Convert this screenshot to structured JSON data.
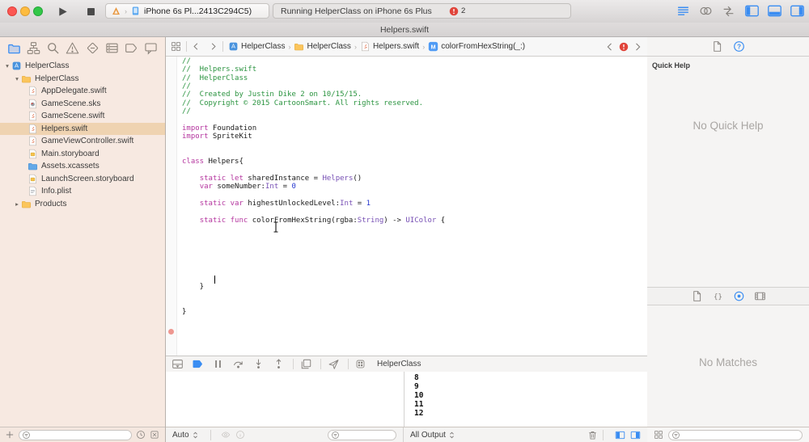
{
  "window": {
    "title": "Helpers.swift"
  },
  "toolbar": {
    "scheme": {
      "device_text": "iPhone 6s Pl...2413C294C5)"
    },
    "status": {
      "text": "Running HelperClass on iPhone 6s Plus",
      "error_count": "2"
    },
    "editor_buttons": [
      {
        "name": "standard-editor",
        "active": true
      },
      {
        "name": "assistant-editor"
      },
      {
        "name": "version-editor"
      }
    ],
    "view_buttons": [
      {
        "name": "navigator-panel",
        "active": true
      },
      {
        "name": "debug-panel",
        "active": true
      },
      {
        "name": "inspector-panel",
        "active": true
      }
    ]
  },
  "navigator": {
    "toolbar": [
      {
        "name": "project-navigator",
        "active": true
      },
      {
        "name": "symbol-navigator"
      },
      {
        "name": "find-navigator"
      },
      {
        "name": "issue-navigator"
      },
      {
        "name": "test-navigator"
      },
      {
        "name": "debug-navigator"
      },
      {
        "name": "breakpoint-navigator"
      },
      {
        "name": "report-navigator"
      }
    ],
    "rows": [
      {
        "label": "HelperClass",
        "level": 0,
        "icon": "project",
        "disclosure": "open"
      },
      {
        "label": "HelperClass",
        "level": 1,
        "icon": "folder",
        "disclosure": "open"
      },
      {
        "label": "AppDelegate.swift",
        "level": 2,
        "icon": "swift"
      },
      {
        "label": "GameScene.sks",
        "level": 2,
        "icon": "sks"
      },
      {
        "label": "GameScene.swift",
        "level": 2,
        "icon": "swift"
      },
      {
        "label": "Helpers.swift",
        "level": 2,
        "icon": "swift",
        "selected": true
      },
      {
        "label": "GameViewController.swift",
        "level": 2,
        "icon": "swift"
      },
      {
        "label": "Main.storyboard",
        "level": 2,
        "icon": "storyboard"
      },
      {
        "label": "Assets.xcassets",
        "level": 2,
        "icon": "assets"
      },
      {
        "label": "LaunchScreen.storyboard",
        "level": 2,
        "icon": "storyboard"
      },
      {
        "label": "Info.plist",
        "level": 2,
        "icon": "plist"
      },
      {
        "label": "Products",
        "level": 1,
        "icon": "folder",
        "disclosure": "closed"
      }
    ],
    "bottom_left_icons": [
      {
        "name": "add"
      }
    ],
    "bottom_right_icons": [
      {
        "name": "clock"
      },
      {
        "name": "flag-box"
      }
    ]
  },
  "jumpbar": {
    "left_icons": [
      {
        "name": "related-items"
      }
    ],
    "nav_icons": [
      {
        "name": "back"
      },
      {
        "name": "forward"
      }
    ],
    "items": [
      {
        "icon": "project",
        "label": "HelperClass"
      },
      {
        "icon": "folder",
        "label": "HelperClass"
      },
      {
        "icon": "swift",
        "label": "Helpers.swift"
      },
      {
        "icon": "method",
        "label": "colorFromHexString(_:)"
      }
    ],
    "issue_nav_icons": [
      {
        "name": "back"
      },
      {
        "name": "error-badge"
      },
      {
        "name": "forward"
      }
    ]
  },
  "code": {
    "lines": [
      [
        {
          "s": "//",
          "c": "c"
        }
      ],
      [
        {
          "s": "//  Helpers.swift",
          "c": "c"
        }
      ],
      [
        {
          "s": "//  HelperClass",
          "c": "c"
        }
      ],
      [
        {
          "s": "//",
          "c": "c"
        }
      ],
      [
        {
          "s": "//  Created by Justin Dike 2 on 10/15/15.",
          "c": "c"
        }
      ],
      [
        {
          "s": "//  Copyright © 2015 CartoonSmart. All rights reserved.",
          "c": "c"
        }
      ],
      [
        {
          "s": "//",
          "c": "c"
        }
      ],
      [],
      [
        {
          "s": "import",
          "c": "k"
        },
        {
          "s": " Foundation",
          "c": "p"
        }
      ],
      [
        {
          "s": "import",
          "c": "k"
        },
        {
          "s": " SpriteKit",
          "c": "p"
        }
      ],
      [],
      [],
      [
        {
          "s": "class",
          "c": "k"
        },
        {
          "s": " Helpers{",
          "c": "p"
        }
      ],
      [],
      [
        {
          "s": "    ",
          "c": "p"
        },
        {
          "s": "static",
          "c": "k"
        },
        {
          "s": " ",
          "c": "p"
        },
        {
          "s": "let",
          "c": "k"
        },
        {
          "s": " sharedInstance = ",
          "c": "p"
        },
        {
          "s": "Helpers",
          "c": "t"
        },
        {
          "s": "()",
          "c": "p"
        }
      ],
      [
        {
          "s": "    ",
          "c": "p"
        },
        {
          "s": "var",
          "c": "k"
        },
        {
          "s": " someNumber:",
          "c": "p"
        },
        {
          "s": "Int",
          "c": "t"
        },
        {
          "s": " = ",
          "c": "p"
        },
        {
          "s": "0",
          "c": "n"
        }
      ],
      [],
      [
        {
          "s": "    ",
          "c": "p"
        },
        {
          "s": "static",
          "c": "k"
        },
        {
          "s": " ",
          "c": "p"
        },
        {
          "s": "var",
          "c": "k"
        },
        {
          "s": " highestUnlockedLevel:",
          "c": "p"
        },
        {
          "s": "Int",
          "c": "t"
        },
        {
          "s": " = ",
          "c": "p"
        },
        {
          "s": "1",
          "c": "n"
        }
      ],
      [],
      [
        {
          "s": "    ",
          "c": "p"
        },
        {
          "s": "static",
          "c": "k"
        },
        {
          "s": " ",
          "c": "p"
        },
        {
          "s": "func",
          "c": "k"
        },
        {
          "s": " colorFromHexString(rgba:",
          "c": "p"
        },
        {
          "s": "String",
          "c": "t"
        },
        {
          "s": ") -> ",
          "c": "p"
        },
        {
          "s": "UIColor",
          "c": "t"
        },
        {
          "s": " {",
          "c": "p"
        }
      ],
      [],
      [],
      [],
      [],
      [],
      [],
      [],
      [
        {
          "s": "    }",
          "c": "p"
        }
      ],
      [],
      [],
      [
        {
          "s": "}",
          "c": "p"
        }
      ]
    ]
  },
  "debug": {
    "toolbar": [
      {
        "name": "hide-debug-area"
      },
      {
        "name": "breakpoints",
        "active": true
      },
      {
        "name": "pause"
      },
      {
        "name": "step-over"
      },
      {
        "name": "step-into"
      },
      {
        "name": "step-out"
      },
      {
        "sep": true
      },
      {
        "name": "view-debugger"
      },
      {
        "sep": true
      },
      {
        "name": "simulate-location"
      },
      {
        "sep": true
      }
    ],
    "process_label": "HelperClass",
    "console_lines": [
      "8",
      "9",
      "10",
      "11",
      "12"
    ],
    "variables_scope": "Auto",
    "variables_icons": [
      {
        "name": "eye",
        "disabled": true
      },
      {
        "name": "info",
        "disabled": true
      }
    ],
    "output_filter": "All Output",
    "console_icons": [
      {
        "name": "trash"
      },
      {
        "sep": true
      },
      {
        "name": "pane-left",
        "active": true
      },
      {
        "name": "pane-right",
        "active": true
      }
    ]
  },
  "inspector": {
    "tabs": [
      {
        "name": "file-inspector"
      },
      {
        "name": "quick-help",
        "active": true
      }
    ],
    "quick_help_title": "Quick Help",
    "quick_help_empty": "No Quick Help",
    "library_tabs": [
      {
        "name": "file-templates"
      },
      {
        "name": "code-snippets"
      },
      {
        "name": "object-library",
        "active": true
      },
      {
        "name": "media-library"
      }
    ],
    "library_empty": "No Matches",
    "bottom_icons": [
      {
        "name": "grid-view"
      }
    ]
  },
  "colors": {
    "accent_blue": "#3a8df2",
    "selection_peach": "#efd3b1",
    "error_red": "#e0443a",
    "comment_green": "#2b9440",
    "keyword_pink": "#b5369f",
    "type_purple": "#7851b5",
    "number_blue": "#2637cf",
    "sidebar_bg": "#f7e9e1"
  }
}
